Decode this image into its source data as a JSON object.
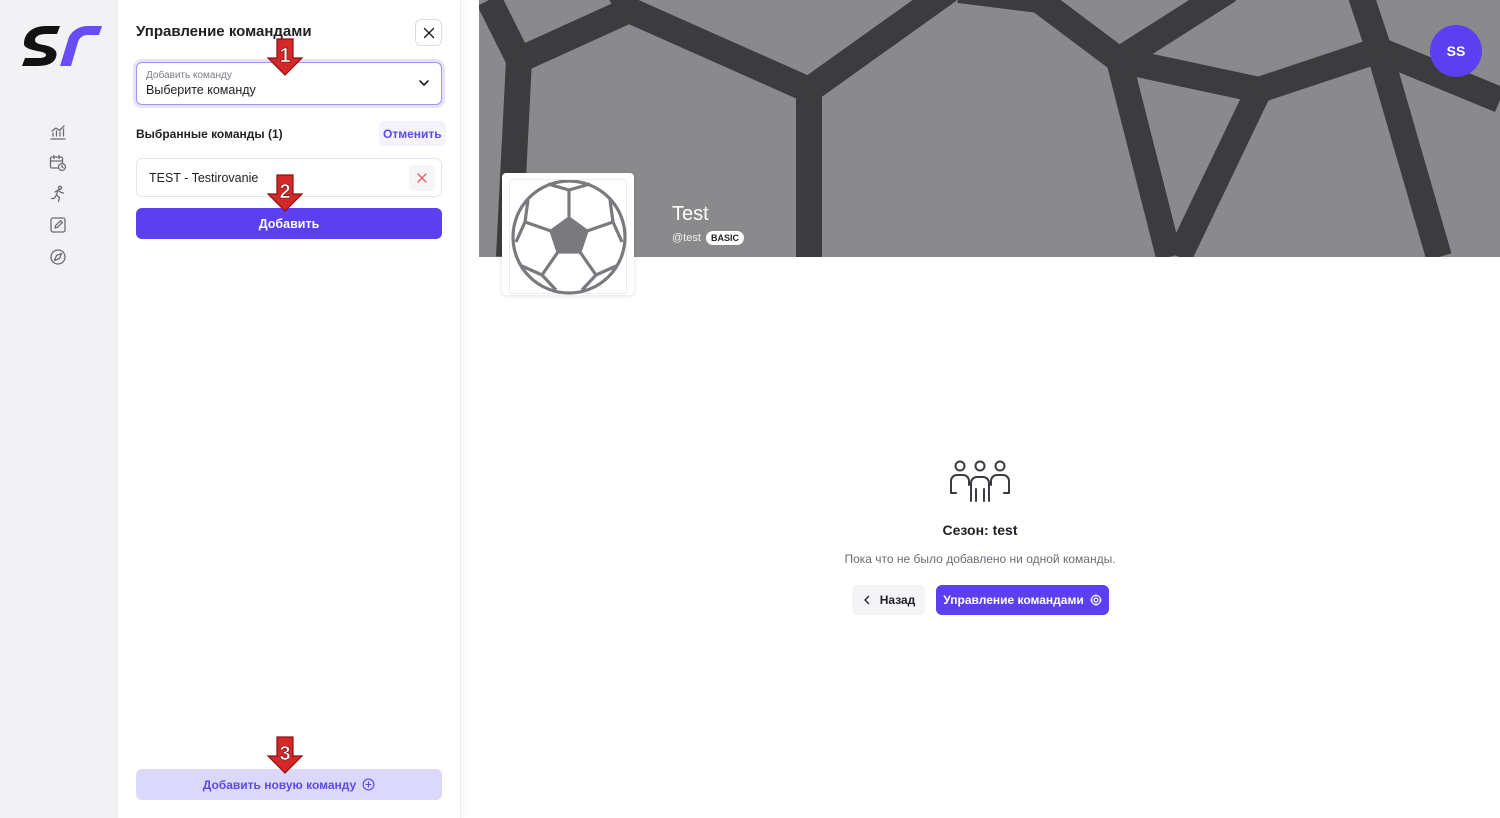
{
  "colors": {
    "accent": "#5b3ff0",
    "accent_soft": "#dcd8fc",
    "rail_bg": "#f2f2f4",
    "banner_bg": "#8a8a8d",
    "banner_lines": "#3c3c3e",
    "step_marker": "#d62828"
  },
  "sidebar": {
    "icons": [
      "chart-icon",
      "calendar-clock-icon",
      "runner-icon",
      "edit-icon",
      "navigation-icon"
    ]
  },
  "panel": {
    "title": "Управление командами",
    "select": {
      "label": "Добавить команду",
      "value": "Выберите команду"
    },
    "selected_title": "Выбранные команды (1)",
    "cancel_label": "Отменить",
    "selected_teams": [
      {
        "label": "TEST - Testirovanie"
      }
    ],
    "add_label": "Добавить",
    "add_new_label": "Добавить новую команду"
  },
  "steps": [
    "1",
    "2",
    "3"
  ],
  "main": {
    "avatar_initials": "SS",
    "team_name": "Test",
    "team_handle": "@test",
    "plan_badge": "BASIC",
    "empty_title": "Сезон: test",
    "empty_description": "Пока что не было добавлено ни одной команды.",
    "back_label": "Назад",
    "manage_label": "Управление командами"
  }
}
